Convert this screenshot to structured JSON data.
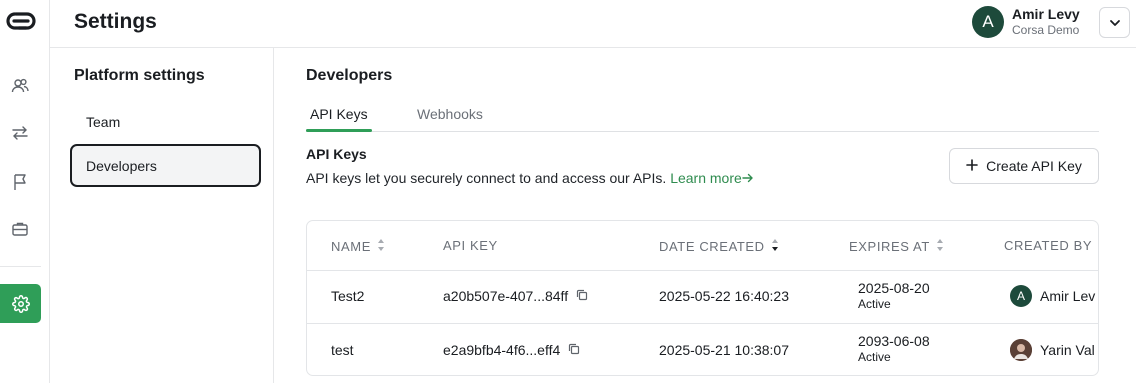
{
  "header": {
    "title": "Settings"
  },
  "user": {
    "initial": "A",
    "name": "Amir Levy",
    "org": "Corsa Demo"
  },
  "rail": {
    "icons": [
      "logo-icon",
      "users-icon",
      "transfer-arrows-icon",
      "flag-icon",
      "briefcase-icon",
      "gear-icon"
    ],
    "accent": "#2f9e58"
  },
  "side": {
    "title": "Platform settings",
    "items": [
      {
        "label": "Team",
        "active": false
      },
      {
        "label": "Developers",
        "active": true
      }
    ]
  },
  "main": {
    "title": "Developers",
    "tabs": [
      {
        "label": "API Keys",
        "active": true
      },
      {
        "label": "Webhooks",
        "active": false
      }
    ],
    "section_title": "API Keys",
    "section_desc": "API keys let you securely connect to and access our APIs.",
    "learn_more": "Learn more",
    "create_label": "Create API Key"
  },
  "table": {
    "columns": [
      "NAME",
      "API KEY",
      "DATE CREATED",
      "EXPIRES AT",
      "CREATED BY"
    ],
    "rows": [
      {
        "name": "Test2",
        "api_key": "a20b507e-407...84ff",
        "date_created": "2025-05-22 16:40:23",
        "expires_at": "2025-08-20",
        "status": "Active",
        "created_by": "Amir Lev",
        "creator_initial": "A"
      },
      {
        "name": "test",
        "api_key": "e2a9bfb4-4f6...eff4",
        "date_created": "2025-05-21 10:38:07",
        "expires_at": "2093-06-08",
        "status": "Active",
        "created_by": "Yarin Val",
        "creator_initial": ""
      }
    ]
  }
}
